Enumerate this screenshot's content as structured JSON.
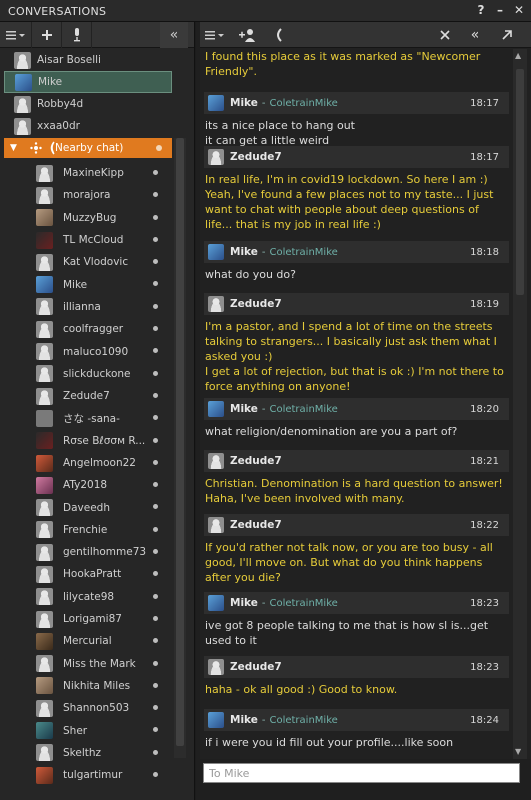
{
  "window": {
    "title": "CONVERSATIONS",
    "help": "?",
    "minimize": "–",
    "close": "✕"
  },
  "left_toolbar": {
    "collapse": "«"
  },
  "conversations": [
    {
      "name": "Aisar Boselli",
      "avatar": "av-head"
    },
    {
      "name": "Mike",
      "avatar": "av-blue"
    },
    {
      "name": "Robby4d",
      "avatar": "av-head"
    },
    {
      "name": "xxaa0dr",
      "avatar": "av-head"
    }
  ],
  "nearby_chat": {
    "label": "(Nearby chat)"
  },
  "participants": [
    {
      "name": "MaxineKipp",
      "avatar": "av-head"
    },
    {
      "name": "morajora",
      "avatar": "av-head"
    },
    {
      "name": "MuzzyBug",
      "avatar": "av-tan"
    },
    {
      "name": "TL McCloud",
      "avatar": "av-dark"
    },
    {
      "name": "Kat Vlodovic",
      "avatar": "av-head"
    },
    {
      "name": "Mike",
      "avatar": "av-blue"
    },
    {
      "name": "illianna",
      "avatar": "av-head"
    },
    {
      "name": "coolfragger",
      "avatar": "av-head"
    },
    {
      "name": "maluco1090",
      "avatar": "av-head"
    },
    {
      "name": "slickduckone",
      "avatar": "av-head"
    },
    {
      "name": "Zedude7",
      "avatar": "av-head"
    },
    {
      "name": "さな -sana-",
      "avatar": "av-flat"
    },
    {
      "name": "Rσse Bℓσσм R...",
      "avatar": "av-dark"
    },
    {
      "name": "Angelmoon22",
      "avatar": "av-red"
    },
    {
      "name": "ATy2018",
      "avatar": "av-pink"
    },
    {
      "name": "Daveedh",
      "avatar": "av-head"
    },
    {
      "name": "Frenchie",
      "avatar": "av-head"
    },
    {
      "name": "gentilhomme73",
      "avatar": "av-head"
    },
    {
      "name": "HookaPratt",
      "avatar": "av-head"
    },
    {
      "name": "lilycate98",
      "avatar": "av-head"
    },
    {
      "name": "Lorigami87",
      "avatar": "av-head"
    },
    {
      "name": "Mercurial",
      "avatar": "av-brown"
    },
    {
      "name": "Miss the Mark",
      "avatar": "av-head"
    },
    {
      "name": "Nikhita Miles",
      "avatar": "av-tan"
    },
    {
      "name": "Shannon503",
      "avatar": "av-head"
    },
    {
      "name": "Sher",
      "avatar": "av-teal"
    },
    {
      "name": "Skelthz",
      "avatar": "av-head"
    },
    {
      "name": "tulgartimur",
      "avatar": "av-red"
    }
  ],
  "chat": {
    "intro_text": "I found this place as it was marked as \"Newcomer Friendly\".",
    "messages": [
      {
        "sender": "Mike",
        "username": "ColetrainMike",
        "time": "18:17",
        "text": "its a nice place to hang out\nit can get a little weird",
        "color": "white"
      },
      {
        "sender": "Zedude7",
        "username": "",
        "time": "18:17",
        "text": "In real life, I'm in covid19 lockdown.  So here I am :)\nYeah, I've found a few places not to my taste... I just want to chat with people about deep questions of life... that is my job in real life :)",
        "color": "yellow"
      },
      {
        "sender": "Mike",
        "username": "ColetrainMike",
        "time": "18:18",
        "text": "what do you do?",
        "color": "white"
      },
      {
        "sender": "Zedude7",
        "username": "",
        "time": "18:19",
        "text": "I'm a pastor, and I spend a lot of time on the streets talking to strangers... I basically just ask them what I asked you :)\nI get a lot of rejection, but that is ok :)  I'm not there to force anything on anyone!",
        "color": "yellow"
      },
      {
        "sender": "Mike",
        "username": "ColetrainMike",
        "time": "18:20",
        "text": "what religion/denomination are you a part of?",
        "color": "white"
      },
      {
        "sender": "Zedude7",
        "username": "",
        "time": "18:21",
        "text": "Christian.  Denomination is a hard question to answer! Haha, I've been involved with many.",
        "color": "yellow"
      },
      {
        "sender": "Zedude7",
        "username": "",
        "time": "18:22",
        "text": "If you'd rather not talk now, or you are too busy - all good, I'll move on.  But what do you think happens after you die?",
        "color": "yellow"
      },
      {
        "sender": "Mike",
        "username": "ColetrainMike",
        "time": "18:23",
        "text": "ive got 8 people talking to me that is how sl is...get used to it",
        "color": "white"
      },
      {
        "sender": "Zedude7",
        "username": "",
        "time": "18:23",
        "text": "haha - ok all good :)  Good to know.",
        "color": "yellow"
      },
      {
        "sender": "Mike",
        "username": "ColetrainMike",
        "time": "18:24",
        "text": "if i were you id fill out your profile....like soon",
        "color": "white"
      }
    ]
  },
  "input": {
    "placeholder": "To Mike"
  },
  "colors": {
    "nearby_accent": "#e07a1f",
    "selected_bg": "#3f5f52",
    "yellow_text": "#e6cc3a",
    "username_teal": "#6fb0a8"
  }
}
